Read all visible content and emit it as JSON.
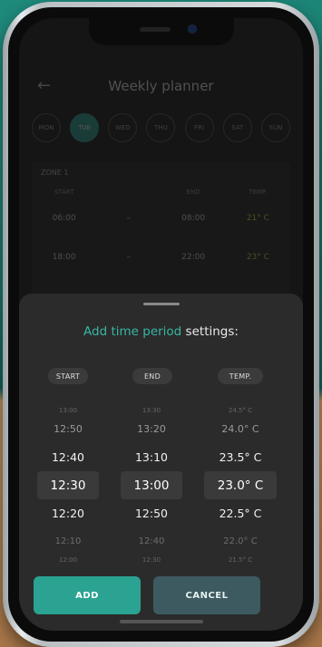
{
  "background_app": {
    "title": "Weekly planner",
    "back_icon": "arrow-left-icon",
    "days": [
      "MON",
      "TUE",
      "WED",
      "THU",
      "FRI",
      "SAT",
      "SUN"
    ],
    "active_day_index": 1,
    "zone": {
      "title": "ZONE 1",
      "headers": [
        "START",
        "",
        "END",
        "TEMP."
      ],
      "rows": [
        {
          "start": "06:00",
          "dash": "–",
          "end": "08:00",
          "temp": "21° C"
        },
        {
          "start": "18:00",
          "dash": "–",
          "end": "22:00",
          "temp": "23° C"
        }
      ]
    }
  },
  "sheet": {
    "title_accent": "Add time period",
    "title_rest": " settings:",
    "labels": {
      "start": "START",
      "end": "END",
      "temp": "TEMP."
    },
    "start_picker": [
      "13:00",
      "12:50",
      "12:40",
      "12:30",
      "12:20",
      "12:10",
      "12:00"
    ],
    "end_picker": [
      "13:30",
      "13:20",
      "13:10",
      "13:00",
      "12:50",
      "12:40",
      "12:30"
    ],
    "temp_picker": [
      "24.5° C",
      "24.0° C",
      "23.5° C",
      "23.0° C",
      "22.5° C",
      "22.0° C",
      "21.5° C"
    ],
    "buttons": {
      "add": "ADD",
      "cancel": "CANCEL"
    }
  },
  "colors": {
    "accent": "#2aa393",
    "cancel": "#3d5a60"
  }
}
